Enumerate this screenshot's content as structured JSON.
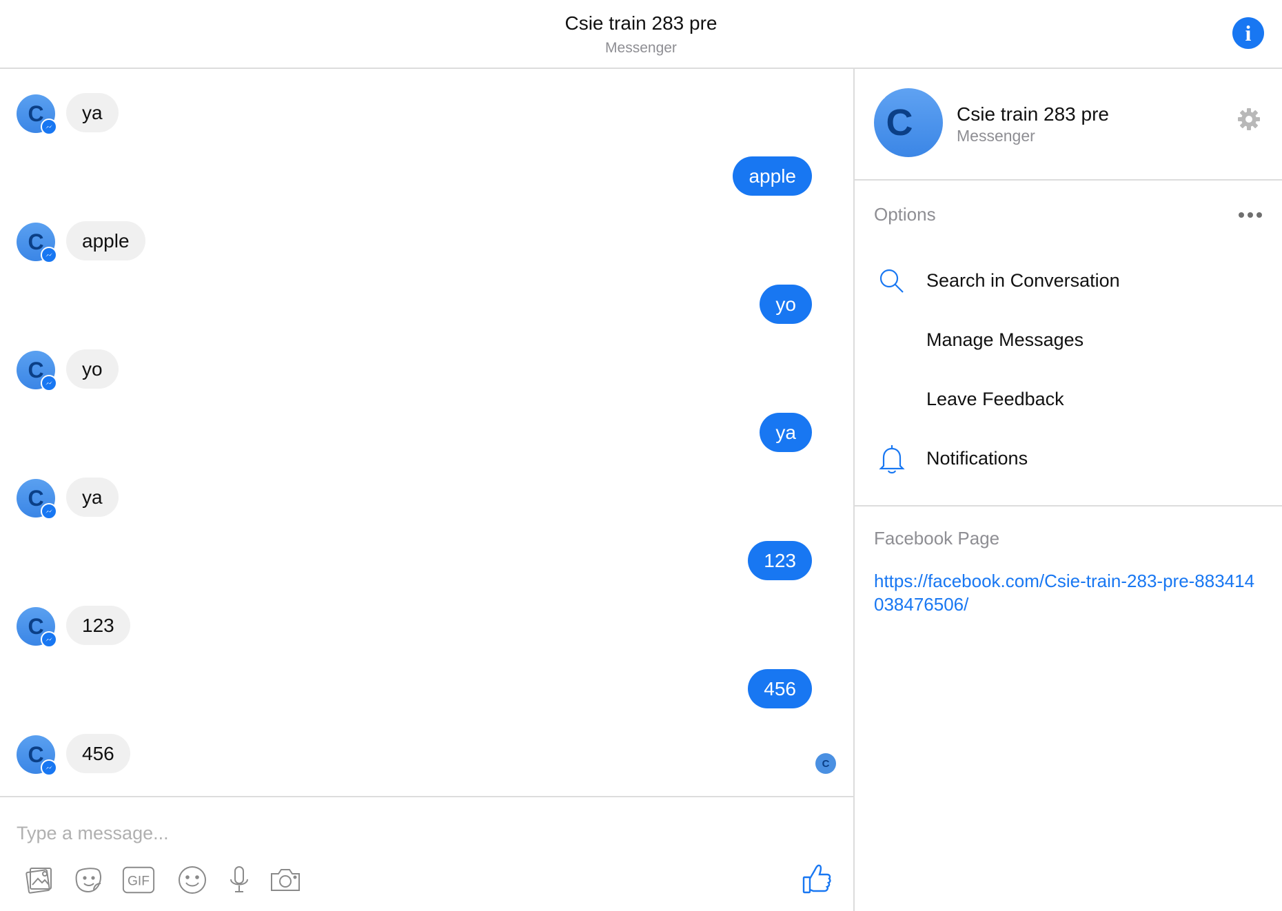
{
  "header": {
    "title": "Csie train 283 pre",
    "subtitle": "Messenger"
  },
  "info_button": {
    "icon": "info-icon",
    "glyph": "i"
  },
  "contact_initial": "C",
  "messages": [
    {
      "side": "in",
      "text": "ya"
    },
    {
      "side": "out",
      "text": "apple"
    },
    {
      "side": "in",
      "text": "apple"
    },
    {
      "side": "out",
      "text": "yo"
    },
    {
      "side": "in",
      "text": "yo"
    },
    {
      "side": "out",
      "text": "ya"
    },
    {
      "side": "in",
      "text": "ya"
    },
    {
      "side": "out",
      "text": "123"
    },
    {
      "side": "in",
      "text": "123"
    },
    {
      "side": "out",
      "text": "456"
    },
    {
      "side": "in",
      "text": "456"
    }
  ],
  "composer": {
    "placeholder": "Type a message...",
    "tools": [
      "photo-icon",
      "sticker-icon",
      "gif-icon",
      "emoji-icon",
      "microphone-icon",
      "camera-icon"
    ],
    "gif_label": "GIF",
    "like_icon": "thumbs-up-icon"
  },
  "panel": {
    "name": "Csie train 283 pre",
    "subtitle": "Messenger",
    "options_heading": "Options",
    "options": [
      {
        "label": "Search in Conversation",
        "icon": "search-icon"
      },
      {
        "label": "Manage Messages",
        "icon": ""
      },
      {
        "label": "Leave Feedback",
        "icon": ""
      },
      {
        "label": "Notifications",
        "icon": "bell-icon"
      }
    ],
    "facebook_heading": "Facebook Page",
    "facebook_url": "https://facebook.com/Csie-train-283-pre-883414038476506/"
  },
  "colors": {
    "accent": "#1877f2",
    "incoming_bubble": "#f0f0f0",
    "divider": "#dcdcdc",
    "muted_text": "#8e8e93"
  }
}
